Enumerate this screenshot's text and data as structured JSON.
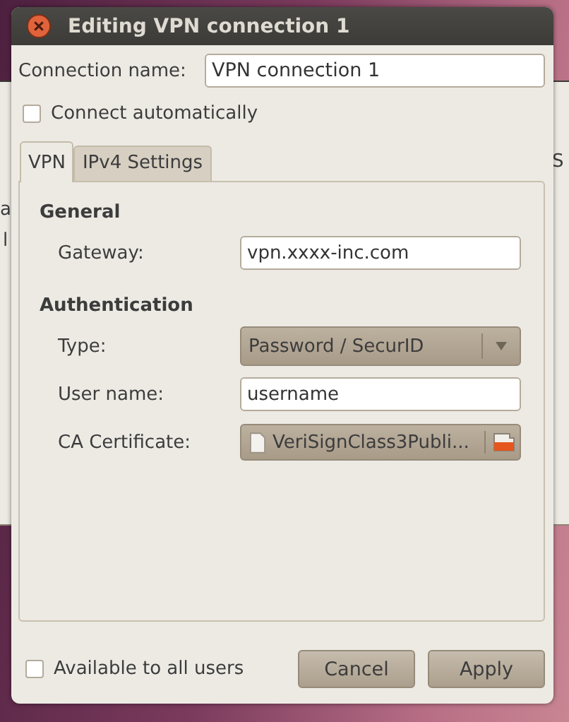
{
  "window": {
    "title": "Editing VPN connection 1"
  },
  "background_window": {
    "fragments": [
      "a",
      "l",
      "S"
    ]
  },
  "connection_name": {
    "label": "Connection name:",
    "value": "VPN connection 1"
  },
  "connect_automatically": {
    "label": "Connect automatically",
    "checked": false
  },
  "tabs": [
    {
      "label": "VPN",
      "selected": true
    },
    {
      "label": "IPv4 Settings",
      "selected": false
    }
  ],
  "sections": [
    {
      "title": "General",
      "rows": [
        {
          "kind": "text",
          "label": "Gateway:",
          "value": "vpn.xxxx-inc.com"
        }
      ]
    },
    {
      "title": "Authentication",
      "rows": [
        {
          "kind": "combo",
          "label": "Type:",
          "value": "Password / SecurID"
        },
        {
          "kind": "text",
          "label": "User name:",
          "value": "username"
        },
        {
          "kind": "file",
          "label": "CA Certificate:",
          "value": "VeriSignClass3Publi..."
        }
      ]
    }
  ],
  "available_to_all_users": {
    "label": "Available to all users",
    "checked": false
  },
  "buttons": [
    "Cancel",
    "Apply"
  ]
}
